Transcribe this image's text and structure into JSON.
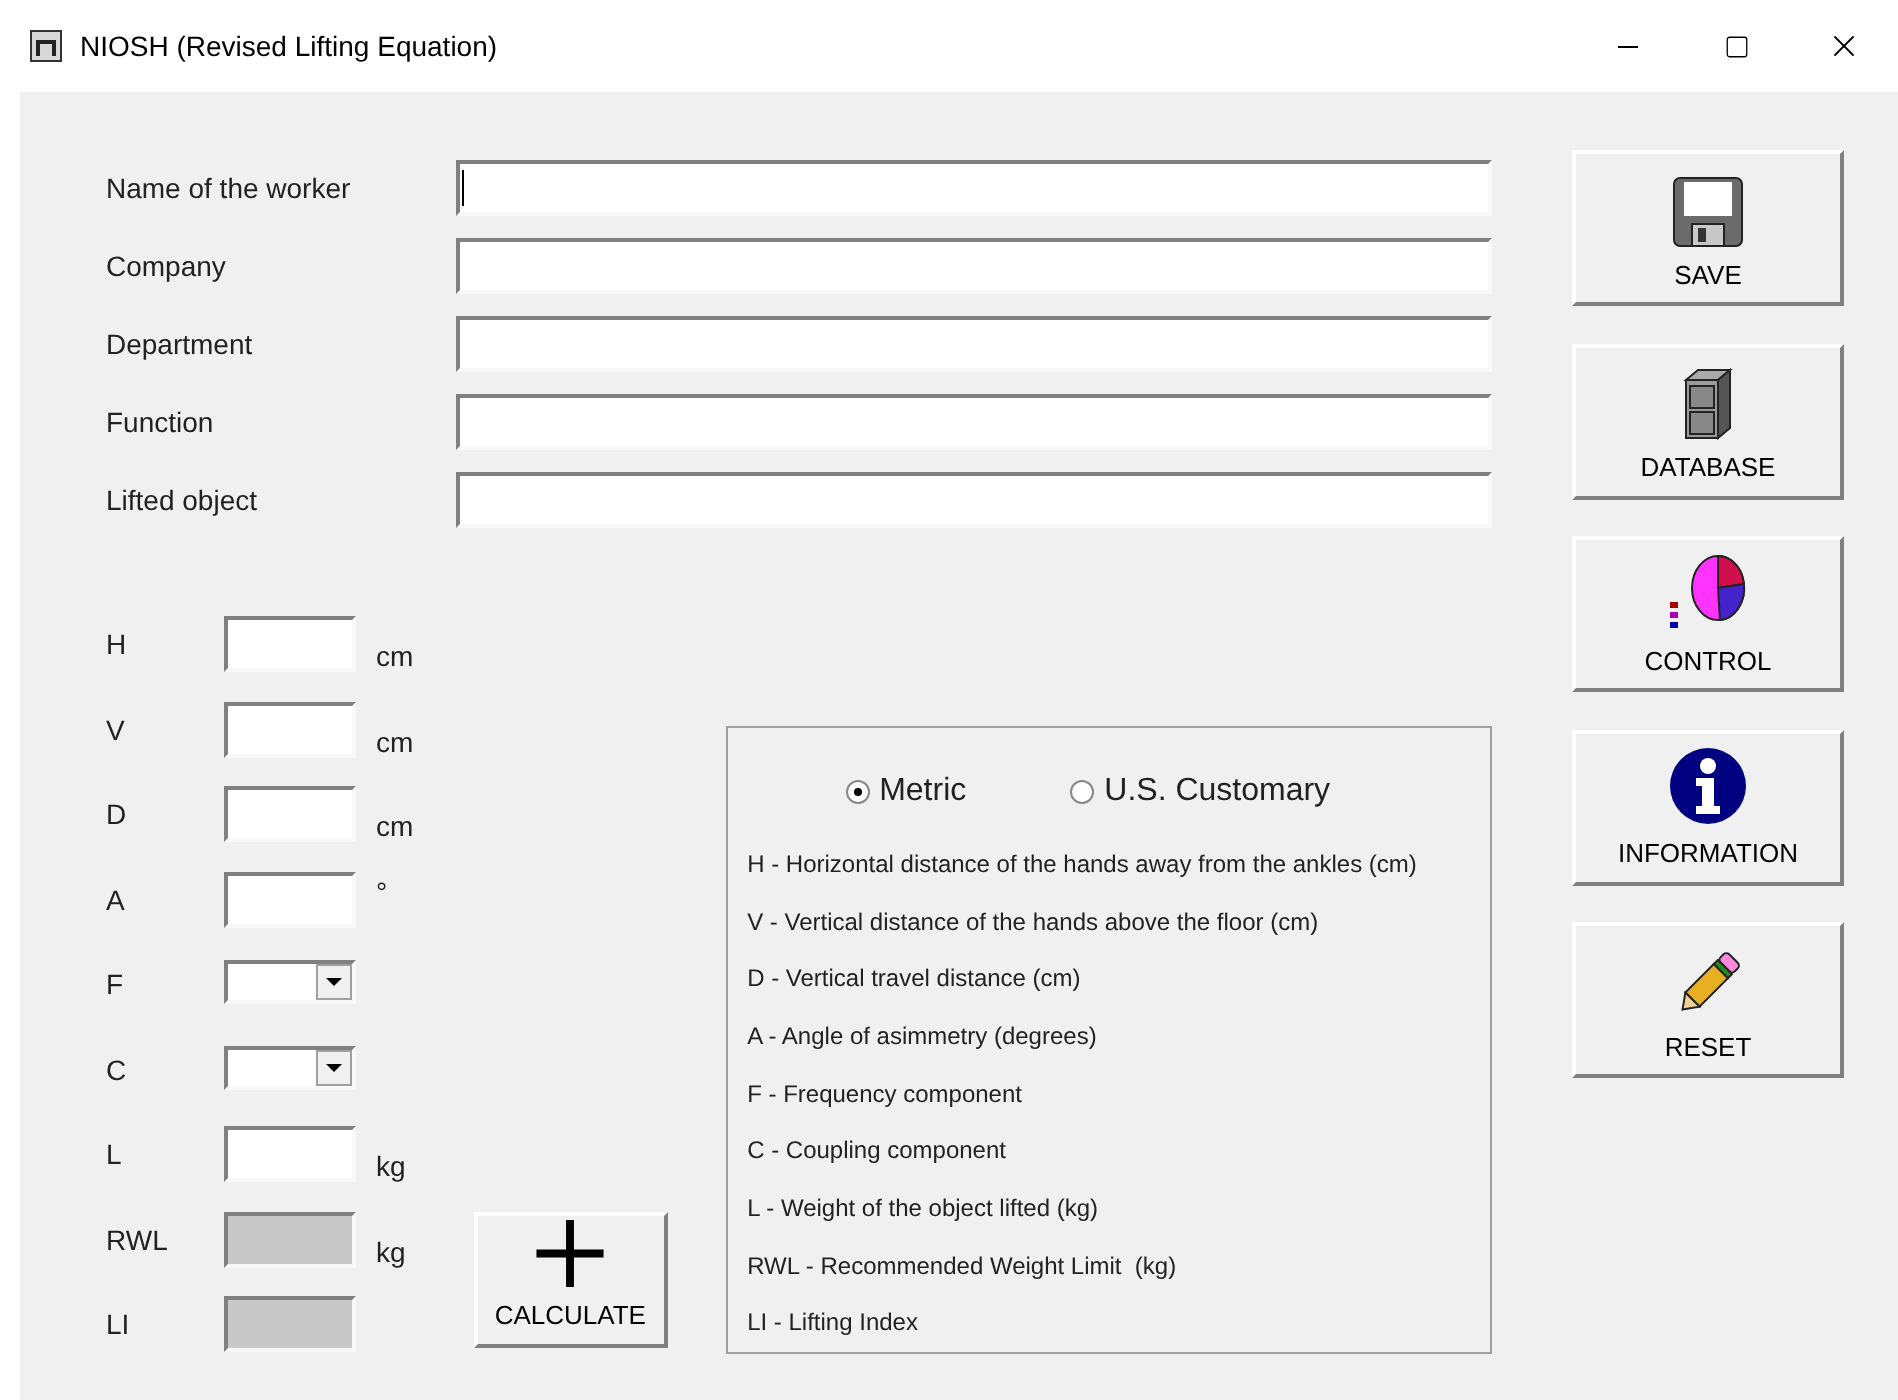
{
  "window": {
    "title": "NIOSH (Revised Lifting Equation)"
  },
  "fields": [
    {
      "label": "Name of the worker",
      "focused": true
    },
    {
      "label": "Company",
      "focused": false
    },
    {
      "label": "Department",
      "focused": false
    },
    {
      "label": "Function",
      "focused": false
    },
    {
      "label": "Lifted object",
      "focused": false
    }
  ],
  "parameters": [
    {
      "label": "H",
      "kind": "text",
      "unit": "cm"
    },
    {
      "label": "V",
      "kind": "text",
      "unit": "cm"
    },
    {
      "label": "D",
      "kind": "text",
      "unit": "cm"
    },
    {
      "label": "A",
      "kind": "text",
      "unit": "°"
    },
    {
      "label": "F",
      "kind": "select"
    },
    {
      "label": "C",
      "kind": "select"
    },
    {
      "label": "L",
      "kind": "text",
      "unit": "kg"
    },
    {
      "label": "RWL",
      "kind": "output",
      "unit": "kg"
    },
    {
      "label": "LI",
      "kind": "output"
    }
  ],
  "calculate_button": "CALCULATE",
  "units": [
    {
      "label": "Metric",
      "selected": true
    },
    {
      "label": "U.S. Customary",
      "selected": false
    }
  ],
  "legend": [
    "H - Horizontal distance of the hands away from the ankles (cm)",
    "V - Vertical distance of the hands above the floor (cm)",
    "D - Vertical travel distance (cm)",
    "A - Angle of asimmetry (degrees)",
    "F - Frequency component",
    "C - Coupling component",
    "L - Weight of the object lifted (kg)",
    "RWL - Recommended Weight Limit  (kg)",
    "LI - Lifting Index"
  ],
  "actions": [
    {
      "kind": "save",
      "label": "SAVE"
    },
    {
      "kind": "database",
      "label": "DATABASE"
    },
    {
      "kind": "control",
      "label": "CONTROL"
    },
    {
      "kind": "information",
      "label": "INFORMATION"
    },
    {
      "kind": "reset",
      "label": "RESET"
    }
  ]
}
